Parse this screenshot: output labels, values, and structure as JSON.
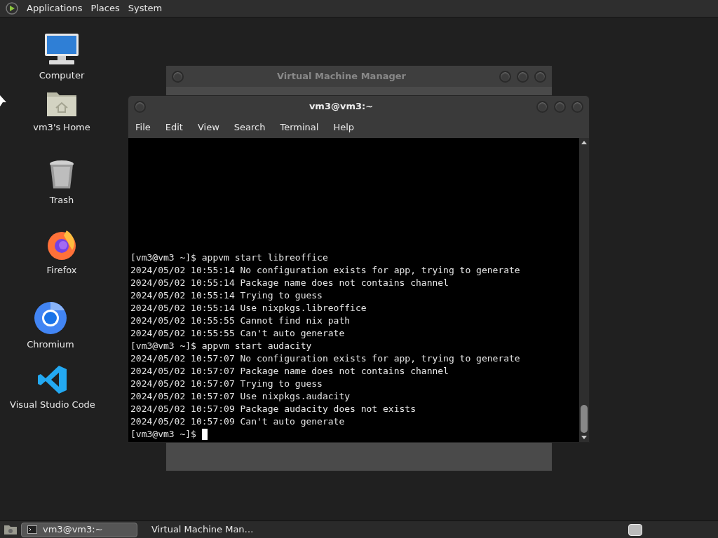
{
  "top_panel": {
    "menus": [
      "Applications",
      "Places",
      "System"
    ]
  },
  "desktop_icons": [
    {
      "label": "Computer",
      "kind": "computer"
    },
    {
      "label": "vm3's Home",
      "kind": "home"
    },
    {
      "label": "Trash",
      "kind": "trash"
    },
    {
      "label": "Firefox",
      "kind": "firefox"
    },
    {
      "label": "Chromium",
      "kind": "chromium"
    },
    {
      "label": "Visual Studio Code",
      "kind": "vscode"
    }
  ],
  "background_window": {
    "title": "Virtual Machine Manager"
  },
  "terminal_window": {
    "title": "vm3@vm3:~",
    "menus": [
      "File",
      "Edit",
      "View",
      "Search",
      "Terminal",
      "Help"
    ],
    "lines": [
      "[vm3@vm3 ~]$ appvm start libreoffice",
      "2024/05/02 10:55:14 No configuration exists for app, trying to generate",
      "2024/05/02 10:55:14 Package name does not contains channel",
      "2024/05/02 10:55:14 Trying to guess",
      "2024/05/02 10:55:14 Use nixpkgs.libreoffice",
      "2024/05/02 10:55:55 Cannot find nix path",
      "2024/05/02 10:55:55 Can't auto generate",
      "[vm3@vm3 ~]$ appvm start audacity",
      "2024/05/02 10:57:07 No configuration exists for app, trying to generate",
      "2024/05/02 10:57:07 Package name does not contains channel",
      "2024/05/02 10:57:07 Trying to guess",
      "2024/05/02 10:57:07 Use nixpkgs.audacity",
      "2024/05/02 10:57:09 Package audacity does not exists",
      "2024/05/02 10:57:09 Can't auto generate"
    ],
    "prompt": "[vm3@vm3 ~]$"
  },
  "taskbar": {
    "tasks": [
      {
        "label": "vm3@vm3:~",
        "selected": true,
        "kind": "terminal"
      },
      {
        "label": "Virtual Machine Man…",
        "selected": false,
        "kind": "vmm"
      }
    ]
  }
}
